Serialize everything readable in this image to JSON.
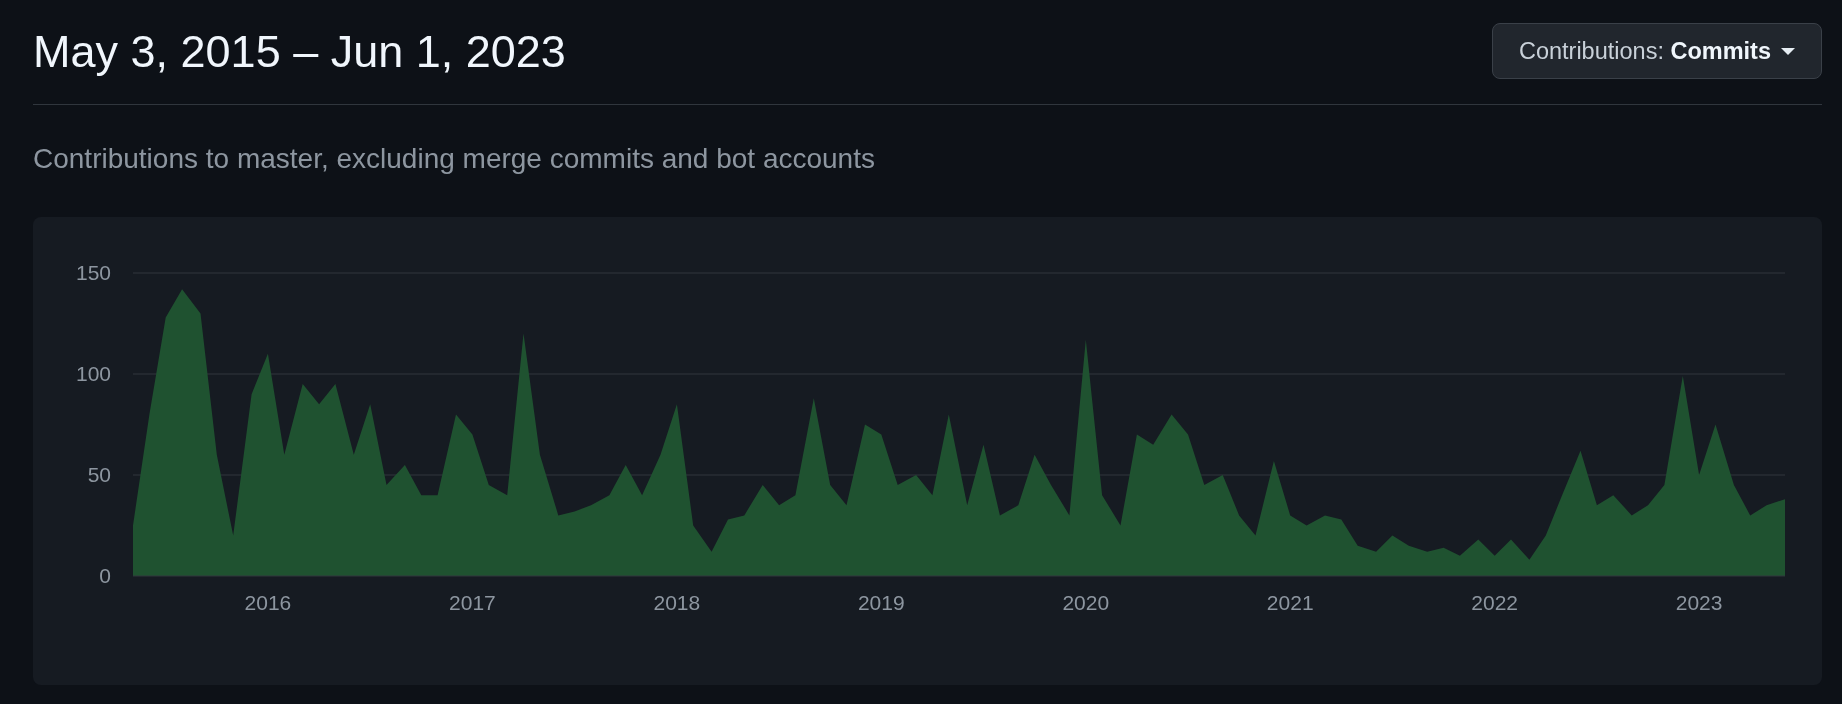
{
  "header": {
    "title": "May 3, 2015 – Jun 1, 2023",
    "dropdown": {
      "label": "Contributions: **Commits**"
    }
  },
  "subtitle": "Contributions to master, excluding merge commits and bot accounts",
  "chart": {
    "chart_data": {
      "type": "area",
      "xlim": [
        2015.34,
        2023.42
      ],
      "ylim": [
        0,
        150
      ],
      "yticks": [
        0,
        50,
        100,
        150
      ],
      "xticks": [
        2016,
        2017,
        2018,
        2019,
        2020,
        2021,
        2022,
        2023
      ],
      "x": [
        2015.34,
        2015.42,
        2015.5,
        2015.58,
        2015.67,
        2015.75,
        2015.83,
        2015.92,
        2016,
        2016.08,
        2016.17,
        2016.25,
        2016.33,
        2016.42,
        2016.5,
        2016.58,
        2016.67,
        2016.75,
        2016.83,
        2016.92,
        2017,
        2017.08,
        2017.17,
        2017.25,
        2017.33,
        2017.42,
        2017.5,
        2017.58,
        2017.67,
        2017.75,
        2017.83,
        2017.92,
        2018,
        2018.08,
        2018.17,
        2018.25,
        2018.33,
        2018.42,
        2018.5,
        2018.58,
        2018.67,
        2018.75,
        2018.83,
        2018.92,
        2019,
        2019.08,
        2019.17,
        2019.25,
        2019.33,
        2019.42,
        2019.5,
        2019.58,
        2019.67,
        2019.75,
        2019.83,
        2019.92,
        2020,
        2020.08,
        2020.17,
        2020.25,
        2020.33,
        2020.42,
        2020.5,
        2020.58,
        2020.67,
        2020.75,
        2020.83,
        2020.92,
        2021,
        2021.08,
        2021.17,
        2021.25,
        2021.33,
        2021.42,
        2021.5,
        2021.58,
        2021.67,
        2021.75,
        2021.83,
        2021.92,
        2022,
        2022.08,
        2022.17,
        2022.25,
        2022.33,
        2022.42,
        2022.5,
        2022.58,
        2022.67,
        2022.75,
        2022.83,
        2022.92,
        2023,
        2023.08,
        2023.17,
        2023.25,
        2023.33,
        2023.42
      ],
      "series": [
        {
          "color": "#1f5230",
          "values": [
            25,
            80,
            128,
            142,
            130,
            60,
            20,
            90,
            110,
            60,
            95,
            85,
            95,
            60,
            85,
            45,
            55,
            40,
            40,
            80,
            70,
            45,
            40,
            120,
            60,
            30,
            32,
            35,
            40,
            55,
            40,
            60,
            85,
            25,
            12,
            28,
            30,
            45,
            35,
            40,
            88,
            45,
            35,
            75,
            70,
            45,
            50,
            40,
            80,
            35,
            65,
            30,
            35,
            60,
            45,
            30,
            117,
            40,
            25,
            70,
            65,
            80,
            70,
            45,
            50,
            30,
            20,
            57,
            30,
            25,
            30,
            28,
            15,
            12,
            20,
            15,
            12,
            14,
            10,
            18,
            10,
            18,
            8,
            20,
            40,
            62,
            35,
            40,
            30,
            35,
            45,
            99,
            50,
            75,
            45,
            30,
            35,
            38
          ]
        }
      ]
    }
  }
}
